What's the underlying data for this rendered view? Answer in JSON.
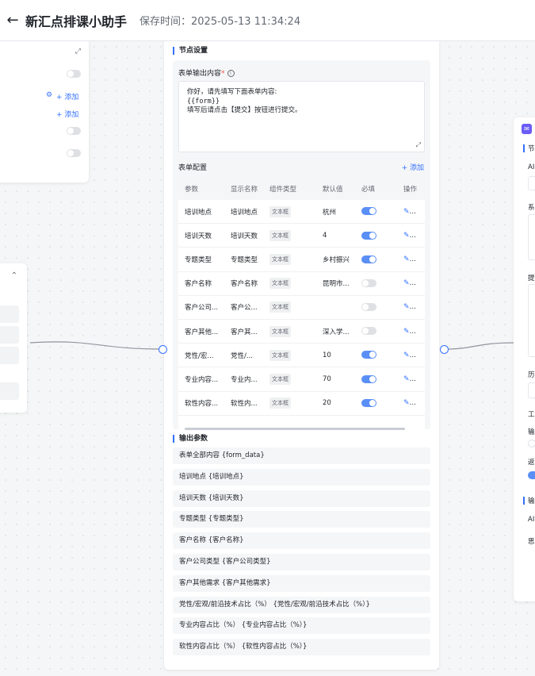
{
  "header": {
    "back_icon": "arrow-left-icon",
    "title": "新汇点排课小助手",
    "save_time": "保存时间：2025-05-13 11:34:24"
  },
  "left_node": {
    "add1": "+ 添加",
    "add2": "+ 添加"
  },
  "center": {
    "section_node_settings": "节点设置",
    "form_output_label": "表单输出内容",
    "form_output_lines": [
      "你好，请先填写下面表单内容:",
      "{{form}}",
      "填写后请点击【提交】按钮进行提交。"
    ],
    "form_config_label": "表单配置",
    "add_label": "+ 添加",
    "table": {
      "headers": [
        "参数",
        "显示名称",
        "组件类型",
        "默认值",
        "必填",
        "操作"
      ],
      "rows": [
        {
          "param": "培训地点",
          "display": "培训地点",
          "type": "文本框",
          "default": "杭州",
          "required": true
        },
        {
          "param": "培训天数",
          "display": "培训天数",
          "type": "文本框",
          "default": "4",
          "required": true
        },
        {
          "param": "专题类型",
          "display": "专题类型",
          "type": "文本框",
          "default": "乡村振兴",
          "required": true
        },
        {
          "param": "客户名称",
          "display": "客户名称",
          "type": "文本框",
          "default": "昆明市...",
          "required": false
        },
        {
          "param": "客户公司...",
          "display": "客户公...",
          "type": "文本框",
          "default": "",
          "required": false
        },
        {
          "param": "客户其他...",
          "display": "客户其...",
          "type": "文本框",
          "default": "深入学...",
          "required": false
        },
        {
          "param": "党性/宏...",
          "display": "党性/...",
          "type": "文本框",
          "default": "10",
          "required": true
        },
        {
          "param": "专业内容...",
          "display": "专业内...",
          "type": "文本框",
          "default": "70",
          "required": true
        },
        {
          "param": "软性内容...",
          "display": "软性内...",
          "type": "文本框",
          "default": "20",
          "required": true
        }
      ]
    },
    "section_output_params": "输出参数",
    "outputs": [
      "表单全部内容 {form_data}",
      "培训地点 {培训地点}",
      "培训天数 {培训天数}",
      "专题类型 {专题类型}",
      "客户名称 {客户名称}",
      "客户公司类型 {客户公司类型}",
      "客户其他需求 {客户其他需求}",
      "党性/宏观/前沿技术占比（%） {党性/宏观/前沿技术占比（%）}",
      "专业内容占比（%） {专业内容占比（%）}",
      "软性内容占比（%） {软性内容占比（%）}"
    ]
  },
  "right_node": {
    "t1": "节",
    "t2": "AI",
    "t3": "系",
    "t4": "提",
    "t5": "历",
    "t6": "工",
    "t7": "输",
    "t8": "返",
    "t9": "输",
    "t10": "AI",
    "t11": "思"
  },
  "colors": {
    "accent": "#3370ff",
    "toggle_on": "#5a8ff5",
    "toggle_off": "#dee0e3"
  }
}
